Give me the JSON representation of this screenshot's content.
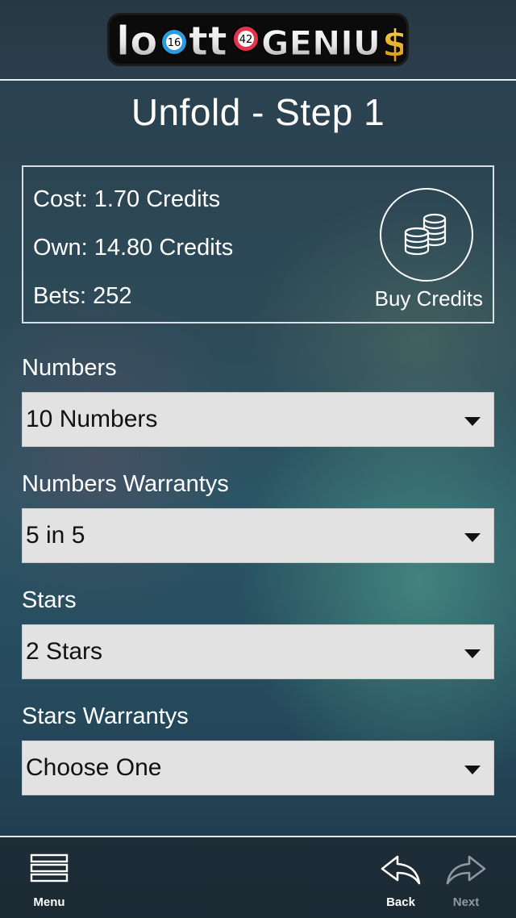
{
  "header": {
    "logo": {
      "text_left": "lo",
      "ball1": "16",
      "text_mid": "tt",
      "ball2": "42",
      "text_right": "GENIU",
      "dollar": "$",
      "colors": {
        "ball1": "#2a9be0",
        "ball2": "#e5334a",
        "dollar": "#f3b21b"
      }
    }
  },
  "page": {
    "title": "Unfold - Step 1"
  },
  "info": {
    "cost": "Cost: 1.70 Credits",
    "own": "Own: 14.80 Credits",
    "bets": "Bets: 252",
    "buy_label": "Buy Credits",
    "buy_icon": "coins-icon"
  },
  "form": {
    "numbers": {
      "label": "Numbers",
      "value": "10 Numbers"
    },
    "numbers_warrantys": {
      "label": "Numbers Warrantys",
      "value": "5 in 5"
    },
    "stars": {
      "label": "Stars",
      "value": "2 Stars"
    },
    "stars_warrantys": {
      "label": "Stars Warrantys",
      "value": "Choose One"
    }
  },
  "toolbar": {
    "menu": {
      "label": "Menu",
      "icon": "menu-icon"
    },
    "back": {
      "label": "Back",
      "icon": "back-arrow-icon"
    },
    "next": {
      "label": "Next",
      "icon": "forward-arrow-icon",
      "disabled": true
    }
  },
  "colors": {
    "select_bg": "#e2e2e2",
    "text": "#ffffff",
    "disabled": "#8e9aa2"
  }
}
